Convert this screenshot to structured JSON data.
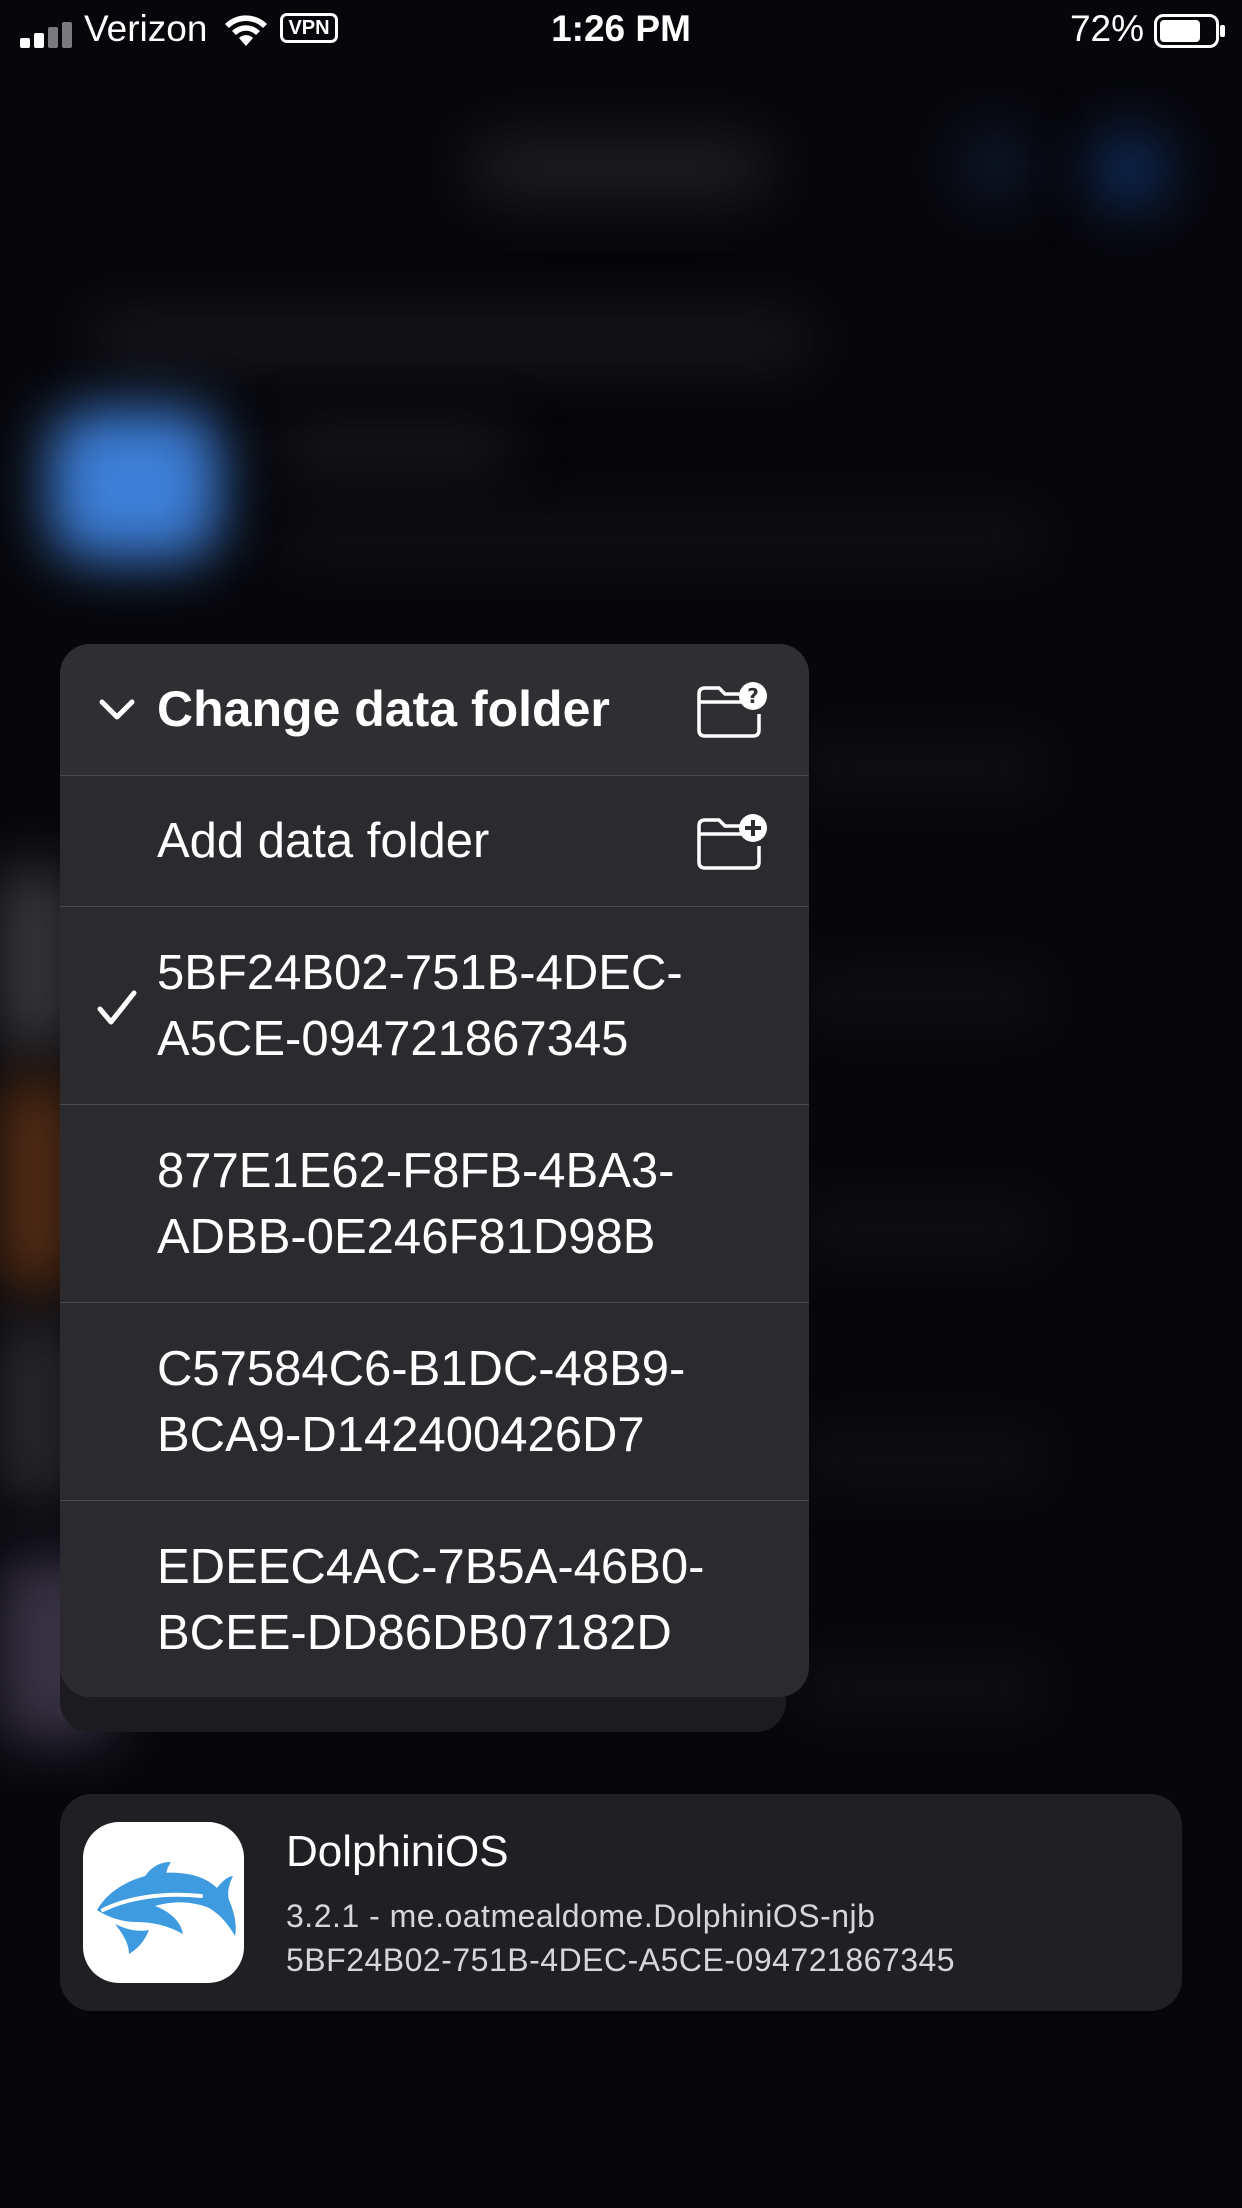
{
  "status_bar": {
    "carrier": "Verizon",
    "vpn": "VPN",
    "time": "1:26 PM",
    "battery_percent": "72%"
  },
  "menu": {
    "header_label": "Change data folder",
    "header_icon": "folder-question-icon",
    "add_label": "Add data folder",
    "add_icon": "folder-plus-icon",
    "folders": [
      {
        "id_line1": "5BF24B02-751B-4DEC-",
        "id_line2": "A5CE-094721867345",
        "selected": true
      },
      {
        "id_line1": "877E1E62-F8FB-4BA3-",
        "id_line2": "ADBB-0E246F81D98B",
        "selected": false
      },
      {
        "id_line1": "C57584C6-B1DC-48B9-",
        "id_line2": "BCA9-D142400426D7",
        "selected": false
      },
      {
        "id_line1": "EDEEC4AC-7B5A-46B0-",
        "id_line2": "BCEE-DD86DB07182D",
        "selected": false
      }
    ]
  },
  "app_card": {
    "name": "DolphiniOS",
    "version_line": "3.2.1 - me.oatmealdome.DolphiniOS-njb",
    "container_id": "5BF24B02-751B-4DEC-A5CE-094721867345",
    "icon": "dolphin-icon"
  },
  "colors": {
    "background": "#07070b",
    "menu_bg": "#2b2b2f",
    "card_bg": "#1f1f24",
    "icon_blue": "#3f9be0"
  }
}
